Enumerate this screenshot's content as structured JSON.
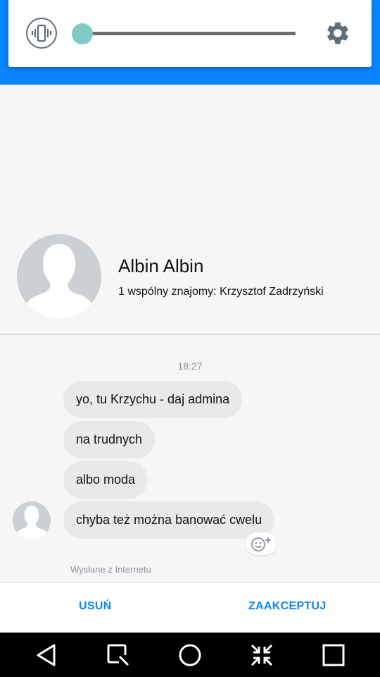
{
  "status": {
    "color": "#0b84ff"
  },
  "volume_panel": {
    "mode_icon": "vibrate-icon",
    "level": 0.0,
    "settings_icon": "gear-icon"
  },
  "profile": {
    "name": "Albin Albin",
    "mutual": "1 wspólny znajomy: Krzysztof Zadrzyński",
    "avatar_icon": "person-silhouette-icon"
  },
  "conversation": {
    "timestamp": "18:27",
    "messages": [
      {
        "text": "yo, tu Krzychu - daj admina"
      },
      {
        "text": "na trudnych"
      },
      {
        "text": "albo moda"
      },
      {
        "text": "chyba też można banować cwelu"
      }
    ],
    "react_icon": "add-reaction-icon",
    "sent_from": "Wysłane z Internetu"
  },
  "actions": {
    "delete_label": "USUŃ",
    "accept_label": "ZAAKCEPTUJ"
  },
  "navigation": {
    "icons": [
      "back-icon",
      "assist-icon",
      "home-icon",
      "collapse-icon",
      "recents-icon"
    ]
  }
}
